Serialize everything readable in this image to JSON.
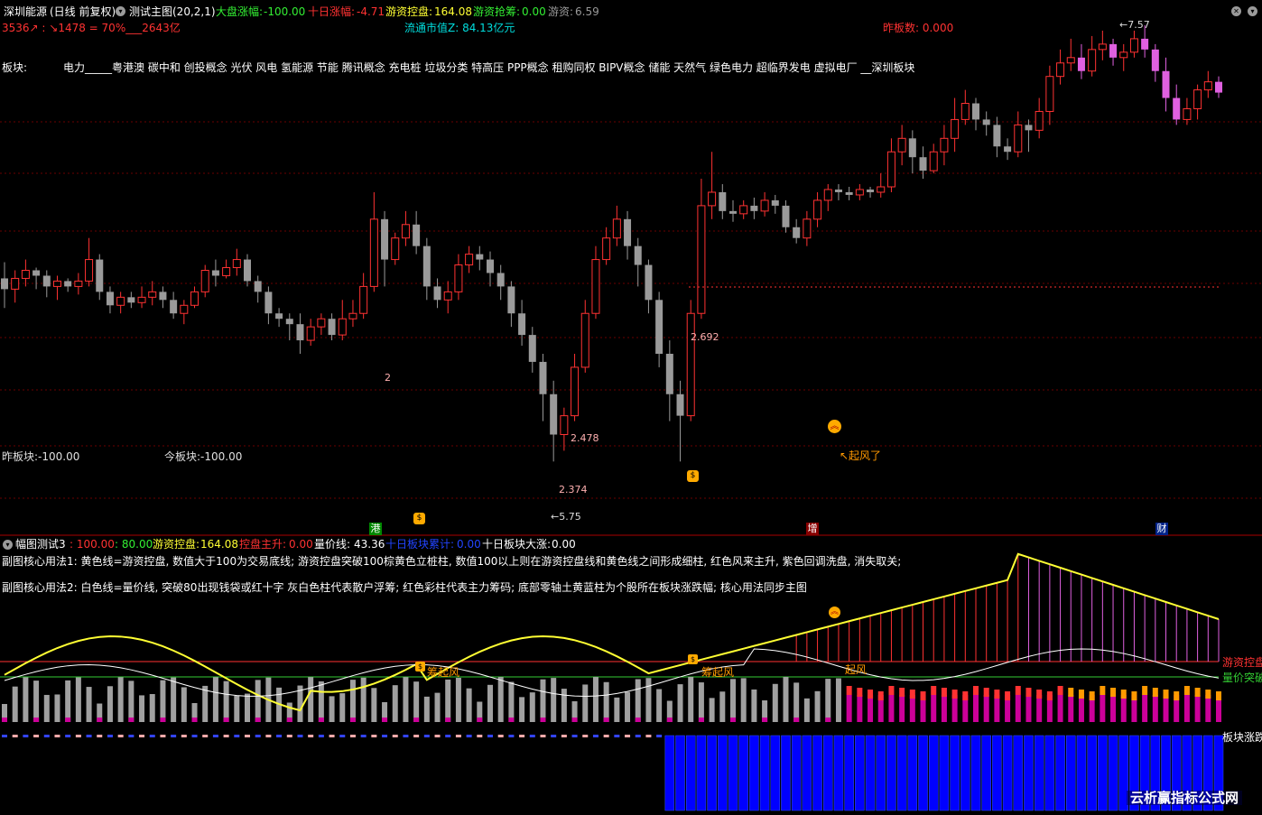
{
  "main_header": {
    "stock_name": "深圳能源",
    "period": "(日线 前复权)",
    "indicator": "测试主图(20,2,1)",
    "market_label": "大盘涨幅:",
    "market_value": "-100.00",
    "ten_day_label": "十日涨幅:",
    "ten_day_value": "-4.71",
    "youzi_label": "游资控盘:",
    "youzi_value": "164.08",
    "youzi_qiang_label": "游资抢筹:",
    "youzi_qiang_value": "0.00",
    "youzi2_label": "游资:",
    "youzi2_value": "6.59"
  },
  "row2": {
    "stats": "3536↗ : ↘1478 = 70%___2643亿",
    "float_cap": "流通市值Z:  84.13亿元",
    "zhaban": "昨板数: 0.000"
  },
  "sectors_label": "板块:",
  "sectors_text": "电力_____粤港澳 碳中和 创投概念 光伏 风电 氢能源 节能 腾讯概念 充电桩 垃圾分类 特高压 PPP概念 租购同权 BIPV概念 储能 天然气 绿色电力 超临界发电 虚拟电厂 __深圳板块",
  "main_labels": {
    "zuo": "昨板块:-100.00",
    "jin": "今板块:-100.00",
    "high": "7.57",
    "low": "5.75",
    "v1": "2",
    "v2": "2.478",
    "v3": "2.374",
    "v4": "2.692",
    "qifeng": "↖起风了"
  },
  "markers": {
    "gang": "港",
    "zeng": "增",
    "cai": "财"
  },
  "sub_header": {
    "name": "幅图测试3",
    "v1": ": 100.00",
    "v2": ": 80.00",
    "youzi_label": "游资控盘:",
    "youzi_value": "164.08",
    "kongpan_label": "控盘主升:",
    "kongpan_value": "0.00",
    "liangjia_label": "量价线:",
    "liangjia_value": "43.36",
    "shiri_leiji_label": "十日板块累计:",
    "shiri_leiji_value": "0.00",
    "shiri_dazhang_label": "十日板块大涨:",
    "shiri_dazhang_value": "0.00"
  },
  "usage1": "副图核心用法1:  黄色线=游资控盘,  数值大于100为交易底线;    游资控盘突破100棕黄色立桩柱,  数值100以上则在游资控盘线和黄色线之间形成细柱,  红色风来主升,  紫色回调洗盘,  消失取关;",
  "usage2": "副图核心用法2:  白色线=量价线,  突破80出现钱袋或红十字    灰白色柱代表散户浮筹;    红色彩柱代表主力筹码;     底部零轴土黄蓝柱为个股所在板块涨跌幅;     核心用法同步主图",
  "sub_labels": {
    "chou1": "筹起风",
    "chou2": "筹起风",
    "qifeng": "起风",
    "youzi": "游资控盘",
    "liangjia": "量价突破",
    "bankuai": "板块涨跌"
  },
  "watermark": "云析赢指标公式网",
  "colors": {
    "up": "#ff3232",
    "down": "#9a9a9a",
    "purple": "#e060e0",
    "yellow": "#ffff33",
    "green": "#33cc33",
    "cyan": "#00dddd",
    "orange": "#ff9900",
    "blue": "#0000ff",
    "magenta": "#cc0099"
  },
  "chart_data": {
    "type": "candlestick",
    "price_high": 7.57,
    "price_low": 5.75,
    "overlay_labels": [
      2,
      2.478,
      2.374,
      2.692
    ],
    "ohlc": [
      [
        6.63,
        6.59,
        6.69,
        6.52
      ],
      [
        6.59,
        6.63,
        6.66,
        6.54
      ],
      [
        6.63,
        6.66,
        6.7,
        6.6
      ],
      [
        6.66,
        6.64,
        6.67,
        6.59
      ],
      [
        6.64,
        6.6,
        6.66,
        6.56
      ],
      [
        6.6,
        6.62,
        6.64,
        6.55
      ],
      [
        6.62,
        6.6,
        6.63,
        6.58
      ],
      [
        6.6,
        6.62,
        6.65,
        6.57
      ],
      [
        6.62,
        6.7,
        6.78,
        6.6
      ],
      [
        6.7,
        6.58,
        6.72,
        6.55
      ],
      [
        6.58,
        6.53,
        6.6,
        6.5
      ],
      [
        6.53,
        6.56,
        6.58,
        6.5
      ],
      [
        6.56,
        6.54,
        6.58,
        6.52
      ],
      [
        6.54,
        6.56,
        6.6,
        6.52
      ],
      [
        6.56,
        6.58,
        6.62,
        6.53
      ],
      [
        6.58,
        6.55,
        6.6,
        6.52
      ],
      [
        6.55,
        6.5,
        6.58,
        6.48
      ],
      [
        6.5,
        6.53,
        6.55,
        6.46
      ],
      [
        6.53,
        6.58,
        6.6,
        6.52
      ],
      [
        6.58,
        6.66,
        6.68,
        6.56
      ],
      [
        6.66,
        6.64,
        6.7,
        6.6
      ],
      [
        6.64,
        6.67,
        6.7,
        6.63
      ],
      [
        6.67,
        6.7,
        6.74,
        6.64
      ],
      [
        6.7,
        6.62,
        6.72,
        6.6
      ],
      [
        6.62,
        6.58,
        6.64,
        6.54
      ],
      [
        6.58,
        6.5,
        6.6,
        6.46
      ],
      [
        6.5,
        6.48,
        6.52,
        6.45
      ],
      [
        6.48,
        6.46,
        6.5,
        6.4
      ],
      [
        6.46,
        6.4,
        6.5,
        6.35
      ],
      [
        6.4,
        6.45,
        6.48,
        6.38
      ],
      [
        6.45,
        6.48,
        6.5,
        6.42
      ],
      [
        6.48,
        6.42,
        6.5,
        6.4
      ],
      [
        6.42,
        6.48,
        6.55,
        6.4
      ],
      [
        6.48,
        6.5,
        6.55,
        6.45
      ],
      [
        6.5,
        6.6,
        6.65,
        6.48
      ],
      [
        6.6,
        6.85,
        6.95,
        6.58
      ],
      [
        6.85,
        6.7,
        6.88,
        6.6
      ],
      [
        6.7,
        6.78,
        6.8,
        6.68
      ],
      [
        6.78,
        6.83,
        6.88,
        6.75
      ],
      [
        6.83,
        6.75,
        6.88,
        6.72
      ],
      [
        6.75,
        6.6,
        6.78,
        6.55
      ],
      [
        6.6,
        6.55,
        6.63,
        6.52
      ],
      [
        6.55,
        6.58,
        6.62,
        6.5
      ],
      [
        6.58,
        6.68,
        6.72,
        6.55
      ],
      [
        6.68,
        6.72,
        6.75,
        6.65
      ],
      [
        6.72,
        6.7,
        6.75,
        6.66
      ],
      [
        6.7,
        6.65,
        6.73,
        6.6
      ],
      [
        6.65,
        6.6,
        6.68,
        6.55
      ],
      [
        6.6,
        6.5,
        6.62,
        6.45
      ],
      [
        6.5,
        6.42,
        6.55,
        6.38
      ],
      [
        6.42,
        6.32,
        6.45,
        6.28
      ],
      [
        6.32,
        6.2,
        6.35,
        6.1
      ],
      [
        6.2,
        6.05,
        6.25,
        5.95
      ],
      [
        6.05,
        6.12,
        6.15,
        5.99
      ],
      [
        6.12,
        6.3,
        6.35,
        6.1
      ],
      [
        6.3,
        6.5,
        6.55,
        6.28
      ],
      [
        6.5,
        6.7,
        6.75,
        6.48
      ],
      [
        6.7,
        6.78,
        6.82,
        6.68
      ],
      [
        6.78,
        6.85,
        6.9,
        6.75
      ],
      [
        6.85,
        6.75,
        6.88,
        6.7
      ],
      [
        6.75,
        6.68,
        6.78,
        6.6
      ],
      [
        6.68,
        6.55,
        6.7,
        6.5
      ],
      [
        6.55,
        6.35,
        6.58,
        6.3
      ],
      [
        6.35,
        6.2,
        6.4,
        6.1
      ],
      [
        6.2,
        6.12,
        6.25,
        5.95
      ],
      [
        6.12,
        6.5,
        6.55,
        6.1
      ],
      [
        6.5,
        6.9,
        7.0,
        6.48
      ],
      [
        6.9,
        6.95,
        7.1,
        6.85
      ],
      [
        6.95,
        6.88,
        6.98,
        6.85
      ],
      [
        6.88,
        6.87,
        6.92,
        6.84
      ],
      [
        6.87,
        6.9,
        6.92,
        6.85
      ],
      [
        6.9,
        6.88,
        6.93,
        6.85
      ],
      [
        6.88,
        6.92,
        6.95,
        6.86
      ],
      [
        6.92,
        6.9,
        6.94,
        6.87
      ],
      [
        6.9,
        6.82,
        6.92,
        6.8
      ],
      [
        6.82,
        6.78,
        6.85,
        6.76
      ],
      [
        6.78,
        6.85,
        6.88,
        6.75
      ],
      [
        6.85,
        6.92,
        6.95,
        6.82
      ],
      [
        6.92,
        6.96,
        6.98,
        6.88
      ],
      [
        6.96,
        6.95,
        6.98,
        6.92
      ],
      [
        6.95,
        6.94,
        6.97,
        6.92
      ],
      [
        6.94,
        6.96,
        6.98,
        6.92
      ],
      [
        6.96,
        6.95,
        6.97,
        6.93
      ],
      [
        6.95,
        6.97,
        7.02,
        6.93
      ],
      [
        6.97,
        7.1,
        7.15,
        6.95
      ],
      [
        7.1,
        7.15,
        7.2,
        7.05
      ],
      [
        7.15,
        7.08,
        7.18,
        7.02
      ],
      [
        7.08,
        7.03,
        7.12,
        7.0
      ],
      [
        7.03,
        7.1,
        7.13,
        7.02
      ],
      [
        7.1,
        7.15,
        7.2,
        7.05
      ],
      [
        7.15,
        7.22,
        7.3,
        7.1
      ],
      [
        7.22,
        7.28,
        7.33,
        7.2
      ],
      [
        7.28,
        7.22,
        7.3,
        7.18
      ],
      [
        7.22,
        7.2,
        7.25,
        7.16
      ],
      [
        7.2,
        7.12,
        7.23,
        7.08
      ],
      [
        7.12,
        7.1,
        7.15,
        7.07
      ],
      [
        7.1,
        7.2,
        7.25,
        7.08
      ],
      [
        7.2,
        7.18,
        7.22,
        7.1
      ],
      [
        7.18,
        7.25,
        7.3,
        7.15
      ],
      [
        7.25,
        7.38,
        7.42,
        7.2
      ],
      [
        7.38,
        7.43,
        7.48,
        7.35
      ],
      [
        7.43,
        7.45,
        7.52,
        7.4
      ],
      [
        7.45,
        7.4,
        7.5,
        7.37
      ],
      [
        7.4,
        7.48,
        7.53,
        7.38
      ],
      [
        7.48,
        7.5,
        7.55,
        7.44
      ],
      [
        7.5,
        7.45,
        7.52,
        7.42
      ],
      [
        7.45,
        7.47,
        7.5,
        7.4
      ],
      [
        7.47,
        7.52,
        7.55,
        7.45
      ],
      [
        7.52,
        7.48,
        7.57,
        7.45
      ],
      [
        7.48,
        7.4,
        7.5,
        7.36
      ],
      [
        7.4,
        7.3,
        7.45,
        7.25
      ],
      [
        7.3,
        7.22,
        7.35,
        7.2
      ],
      [
        7.22,
        7.26,
        7.3,
        7.2
      ],
      [
        7.26,
        7.33,
        7.35,
        7.22
      ],
      [
        7.33,
        7.36,
        7.4,
        7.3
      ],
      [
        7.36,
        7.32,
        7.38,
        7.3
      ]
    ]
  }
}
